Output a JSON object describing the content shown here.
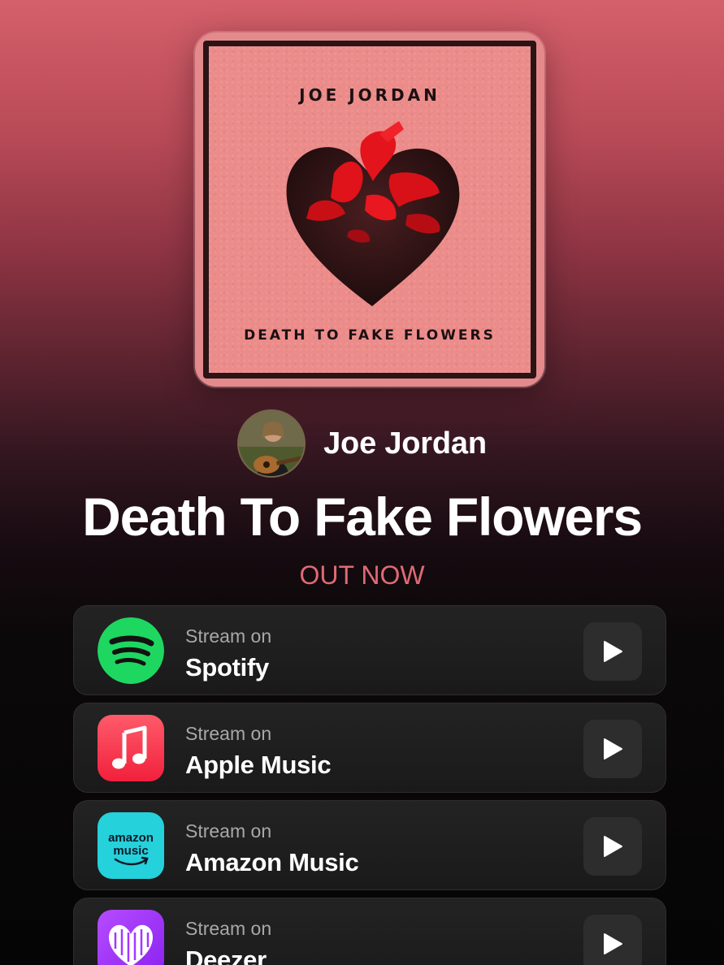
{
  "cover": {
    "artist_text": "JOE JORDAN",
    "title_text": "DEATH TO FAKE FLOWERS"
  },
  "artist": {
    "name": "Joe Jordan",
    "avatar_icon": "artist-avatar-photo"
  },
  "release": {
    "title": "Death To Fake Flowers",
    "status": "OUT NOW"
  },
  "services": [
    {
      "prefix": "Stream on",
      "name": "Spotify",
      "icon": "spotify-icon",
      "color": "#1ed760"
    },
    {
      "prefix": "Stream on",
      "name": "Apple Music",
      "icon": "apple-music-icon",
      "color": "#fa3a4f"
    },
    {
      "prefix": "Stream on",
      "name": "Amazon Music",
      "icon": "amazon-music-icon",
      "color": "#25d1da",
      "icon_text_1": "amazon",
      "icon_text_2": "music"
    },
    {
      "prefix": "Stream on",
      "name": "Deezer",
      "icon": "deezer-icon",
      "color": "#a238ff"
    }
  ],
  "colors": {
    "accent": "#e06a75",
    "background_top": "#d4606a",
    "background_bottom": "#050505"
  }
}
